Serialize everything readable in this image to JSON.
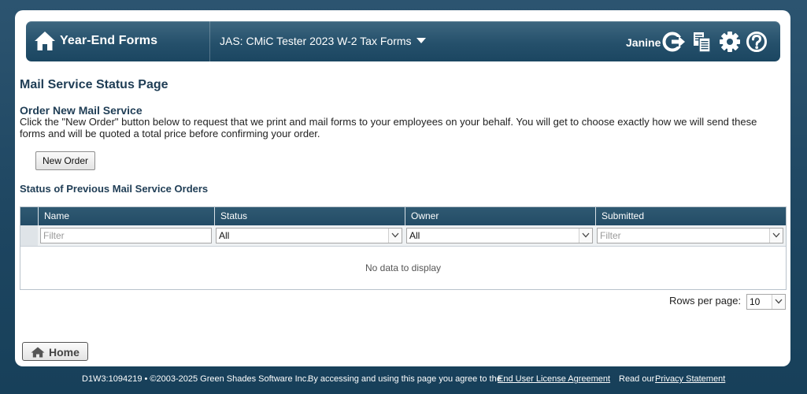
{
  "header": {
    "app_title": "Year-End Forms",
    "company_selector": "JAS: CMiC Tester 2023 W-2 Tax Forms",
    "username": "Janine",
    "icons": [
      "home-icon",
      "sign-out-icon",
      "copy-documents-icon",
      "gear-icon",
      "help-icon"
    ]
  },
  "page": {
    "title": "Mail Service Status Page",
    "order_section_title": "Order New Mail Service",
    "order_description": "Click the \"New Order\" button below to request that we print and mail forms to your employees on your behalf. You will get to choose exactly how we will send these forms and will be quoted a total price before confirming your order.",
    "new_order_button": "New Order",
    "previous_orders_title": "Status of Previous Mail Service Orders"
  },
  "grid": {
    "columns": [
      "Name",
      "Status",
      "Owner",
      "Submitted"
    ],
    "filters": {
      "name_placeholder": "Filter",
      "status_value": "All",
      "owner_value": "All",
      "submitted_placeholder": "Filter"
    },
    "empty_message": "No data to display"
  },
  "pagination": {
    "rows_per_page_label": "Rows per page:",
    "rows_per_page_value": "10"
  },
  "home_button": "Home",
  "footer": {
    "build_copyright": "D1W3:1094219 • ©2003-2025 Green Shades Software Inc.",
    "agreement_text": "By accessing and using this page you agree to the",
    "eula_link": "End User License Agreement",
    "privacy_text": "Read our",
    "privacy_link": "Privacy Statement"
  },
  "colors": {
    "background": "#1f4862",
    "header_bar": "#25506b",
    "grid_header": "#2a5470",
    "title_text": "#1f3d55"
  }
}
